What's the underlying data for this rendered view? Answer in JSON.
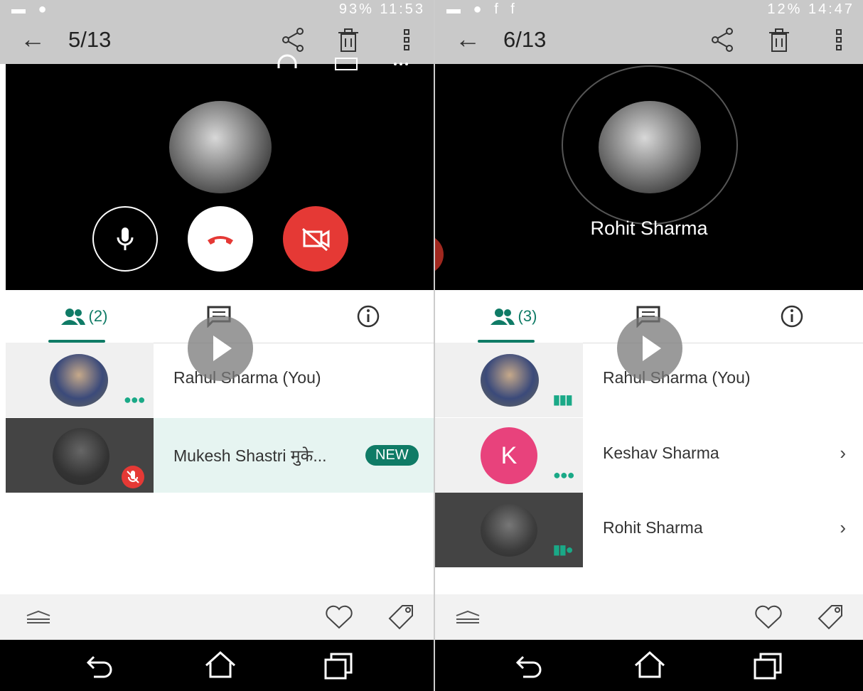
{
  "left": {
    "status": {
      "icons": "▬ ● ",
      "right": "93%  11:53"
    },
    "counter": "5/13",
    "participants_count": "(2)",
    "rows": [
      {
        "name": "Rahul Sharma (You)"
      },
      {
        "name": "Mukesh Shastri मुके...",
        "badge": "NEW"
      }
    ]
  },
  "right": {
    "status": {
      "icons": "▬ ● f f",
      "right": "12%  14:47"
    },
    "counter": "6/13",
    "caller_name": "Rohit Sharma",
    "participants_count": "(3)",
    "rows": [
      {
        "name": "Rahul Sharma (You)"
      },
      {
        "name": "Keshav Sharma",
        "initial": "K",
        "chevron": "›"
      },
      {
        "name": "Rohit Sharma",
        "chevron": "›"
      }
    ]
  },
  "icons": {
    "back": "←",
    "share": "share-icon",
    "trash": "trash-icon",
    "more": "more-vertical-icon",
    "mic": "mic-icon",
    "hangup": "hangup-icon",
    "video_off": "video-off-icon",
    "people": "people-icon",
    "chat": "chat-icon",
    "info": "info-icon",
    "play": "play-icon",
    "menu": "menu-icon",
    "heart": "heart-icon",
    "tag": "tag-icon",
    "nav_back": "nav-back-icon",
    "nav_home": "nav-home-icon",
    "nav_recents": "nav-recents-icon"
  },
  "colors": {
    "accent": "#0f7b66",
    "red": "#e53935",
    "k_avatar": "#e8427c"
  }
}
